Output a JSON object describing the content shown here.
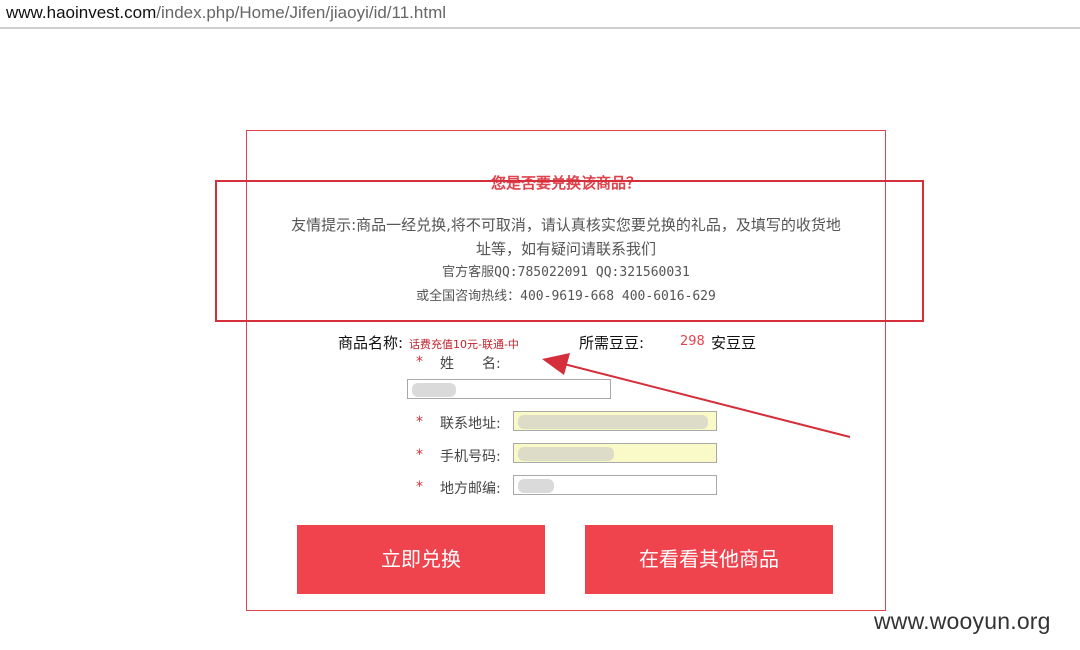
{
  "browser": {
    "url_host": "www.haoinvest.com",
    "url_path": "/index.php/Home/Jifen/jiaoyi/id/11.html"
  },
  "dialog": {
    "title": "您是否要兑换该商品？",
    "tip_line1": "友情提示:商品一经兑换,将不可取消，请认真核实您要兑换的礼品，及填写的收货地",
    "tip_line2": "址等，如有疑问请联系我们",
    "tip_line3": "官方客服QQ:785022091 QQ:321560031",
    "tip_line4": "或全国咨询热线：400-9619-668 400-6016-629"
  },
  "product": {
    "name_label": "商品名称:",
    "name_value": "话费充值10元-联通-中",
    "beans_label": "所需豆豆:",
    "beans_value": "298",
    "beans_unit": "安豆豆"
  },
  "form": {
    "required_mark": "*",
    "name_label": "姓　　名:",
    "address_label": "联系地址:",
    "phone_label": "手机号码:",
    "postcode_label": "地方邮编:",
    "name_value": "",
    "address_value": "",
    "phone_value": "",
    "postcode_value": ""
  },
  "buttons": {
    "exchange": "立即兑换",
    "browse_other": "在看看其他商品"
  },
  "watermark": "www.wooyun.org",
  "colors": {
    "accent": "#ef434e",
    "annotation": "#d42f3a"
  }
}
